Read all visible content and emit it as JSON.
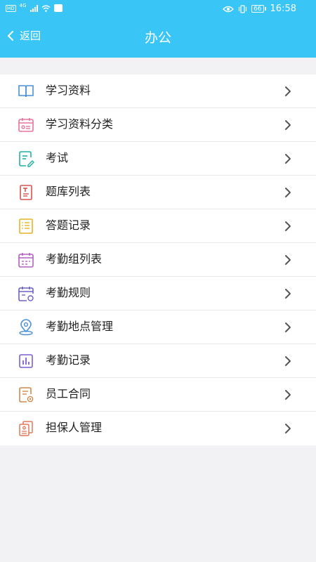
{
  "status_bar": {
    "left_badge": "HD",
    "network": "4G",
    "battery": "66",
    "time": "16:58"
  },
  "header": {
    "back_label": "返回",
    "title": "办公"
  },
  "menu": [
    {
      "label": "学习资料",
      "icon": "book-icon",
      "color": "#4a90d9"
    },
    {
      "label": "学习资料分类",
      "icon": "category-card-icon",
      "color": "#e8739a"
    },
    {
      "label": "考试",
      "icon": "exam-edit-icon",
      "color": "#1fb3a3"
    },
    {
      "label": "题库列表",
      "icon": "question-bank-icon",
      "color": "#d9534f"
    },
    {
      "label": "答题记录",
      "icon": "answer-record-icon",
      "color": "#e6b422"
    },
    {
      "label": "考勤组列表",
      "icon": "calendar-list-icon",
      "color": "#b460c0"
    },
    {
      "label": "考勤规则",
      "icon": "calendar-rule-icon",
      "color": "#6b63c7"
    },
    {
      "label": "考勤地点管理",
      "icon": "location-pin-icon",
      "color": "#4a8fd6"
    },
    {
      "label": "考勤记录",
      "icon": "bar-chart-icon",
      "color": "#7b5fd6"
    },
    {
      "label": "员工合同",
      "icon": "contract-icon",
      "color": "#d4884a"
    },
    {
      "label": "担保人管理",
      "icon": "guarantor-doc-icon",
      "color": "#e0785a"
    }
  ]
}
